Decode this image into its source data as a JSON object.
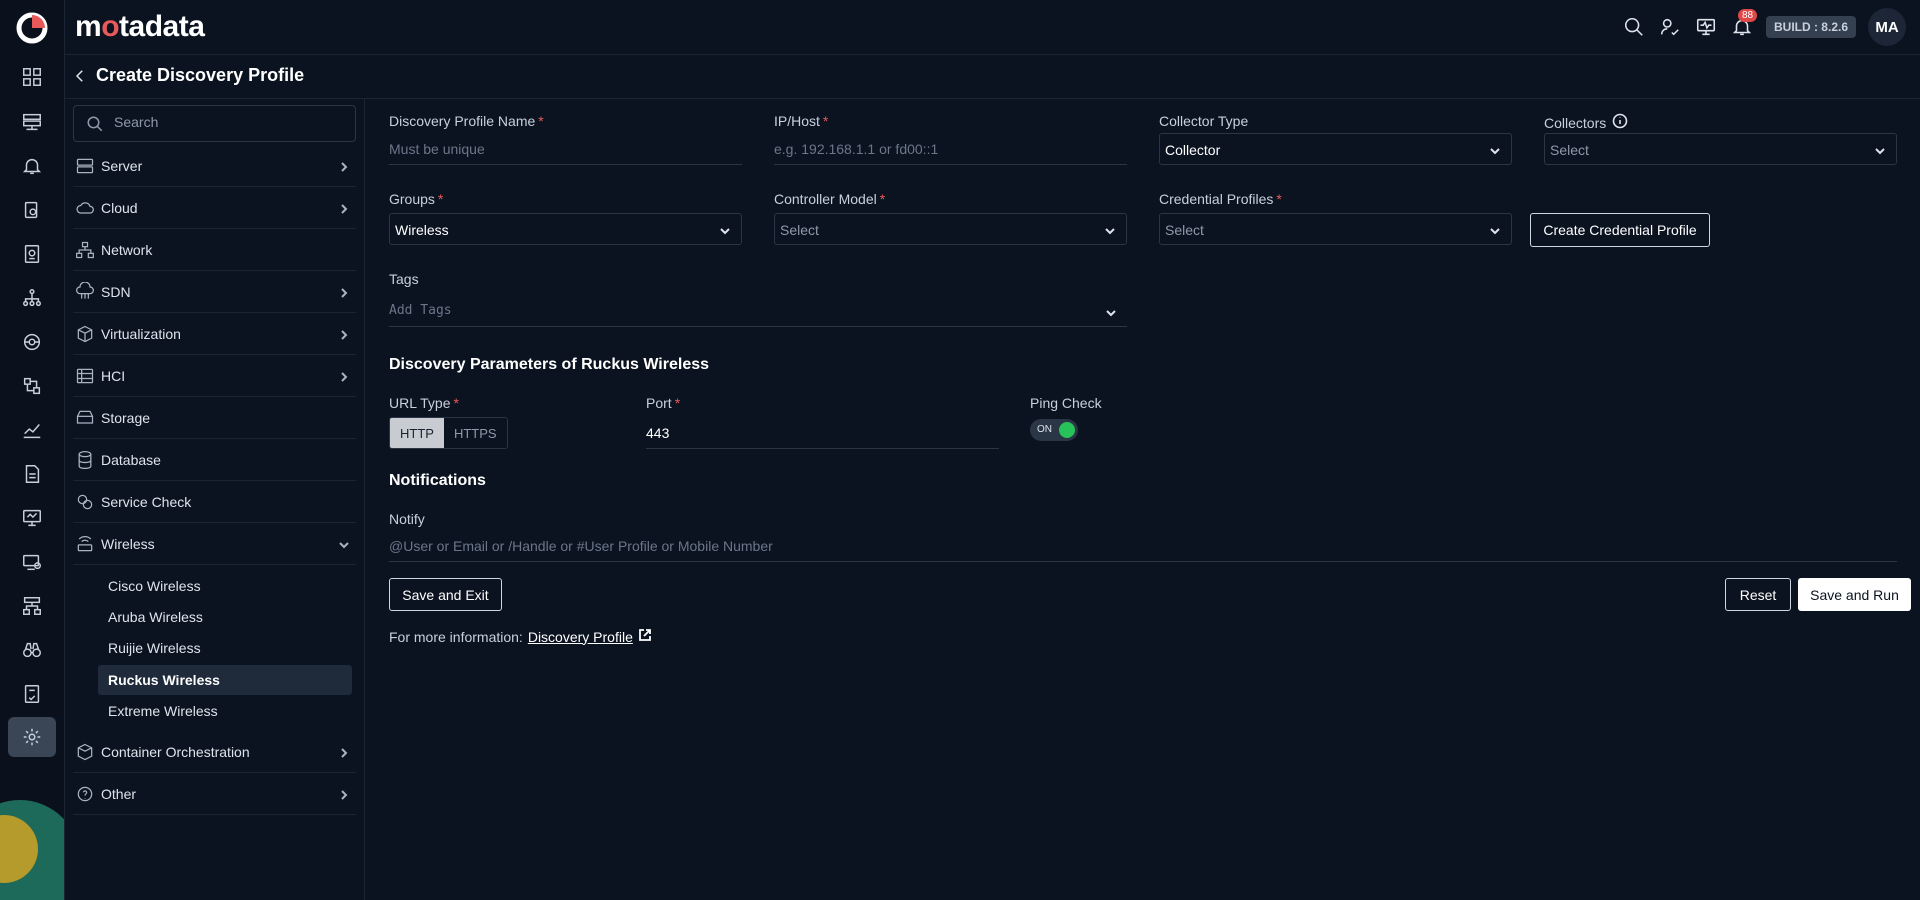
{
  "brand": {
    "name_pre": "m",
    "name_o": "o",
    "name_post": "tadata"
  },
  "header": {
    "notif_count": "88",
    "build": "BUILD : 8.2.6",
    "avatar": "MA"
  },
  "page": {
    "title": "Create Discovery Profile"
  },
  "sidebar": {
    "search_placeholder": "Search",
    "items": [
      {
        "label": "Server",
        "icon": "server-icon",
        "chevron": true
      },
      {
        "label": "Cloud",
        "icon": "cloud-icon",
        "chevron": true
      },
      {
        "label": "Network",
        "icon": "network-icon",
        "chevron": false
      },
      {
        "label": "SDN",
        "icon": "sdn-icon",
        "chevron": true
      },
      {
        "label": "Virtualization",
        "icon": "cube-icon",
        "chevron": true
      },
      {
        "label": "HCI",
        "icon": "hci-icon",
        "chevron": true
      },
      {
        "label": "Storage",
        "icon": "storage-icon",
        "chevron": false
      },
      {
        "label": "Database",
        "icon": "database-icon",
        "chevron": false
      },
      {
        "label": "Service Check",
        "icon": "service-check-icon",
        "chevron": false
      },
      {
        "label": "Wireless",
        "icon": "wireless-icon",
        "chevron": "down"
      },
      {
        "label": "Container Orchestration",
        "icon": "container-icon",
        "chevron": true
      },
      {
        "label": "Other",
        "icon": "help-circle-icon",
        "chevron": true
      }
    ],
    "wireless_sub": [
      {
        "label": "Cisco Wireless"
      },
      {
        "label": "Aruba Wireless"
      },
      {
        "label": "Ruijie Wireless"
      },
      {
        "label": "Ruckus Wireless",
        "active": true
      },
      {
        "label": "Extreme Wireless"
      }
    ]
  },
  "form": {
    "profile_name": {
      "label": "Discovery Profile Name",
      "placeholder": "Must be unique"
    },
    "ip_host": {
      "label": "IP/Host",
      "placeholder": "e.g. 192.168.1.1 or fd00::1"
    },
    "collector_type": {
      "label": "Collector Type",
      "value": "Collector"
    },
    "collectors": {
      "label": "Collectors",
      "placeholder": "Select"
    },
    "groups": {
      "label": "Groups",
      "value": "Wireless"
    },
    "controller_model": {
      "label": "Controller Model",
      "placeholder": "Select"
    },
    "credential_profiles": {
      "label": "Credential Profiles",
      "placeholder": "Select"
    },
    "create_credential_btn": "Create Credential Profile",
    "tags": {
      "label": "Tags",
      "placeholder": "Add Tags"
    },
    "params_title": "Discovery Parameters of Ruckus Wireless",
    "url_type": {
      "label": "URL Type",
      "options": [
        "HTTP",
        "HTTPS"
      ],
      "selected": "HTTP"
    },
    "port": {
      "label": "Port",
      "value": "443"
    },
    "ping_check": {
      "label": "Ping Check",
      "state": "ON"
    },
    "notifications_title": "Notifications",
    "notify": {
      "label": "Notify",
      "placeholder": "@User or Email or /Handle or #User Profile or Mobile Number"
    },
    "save_exit": "Save and Exit",
    "reset": "Reset",
    "save_run": "Save and Run",
    "more_info_prefix": "For more information:",
    "more_info_link": "Discovery Profile"
  },
  "colors": {
    "accent": "#e85a5a",
    "toggle_on": "#27c25a",
    "background": "#0b1320"
  }
}
